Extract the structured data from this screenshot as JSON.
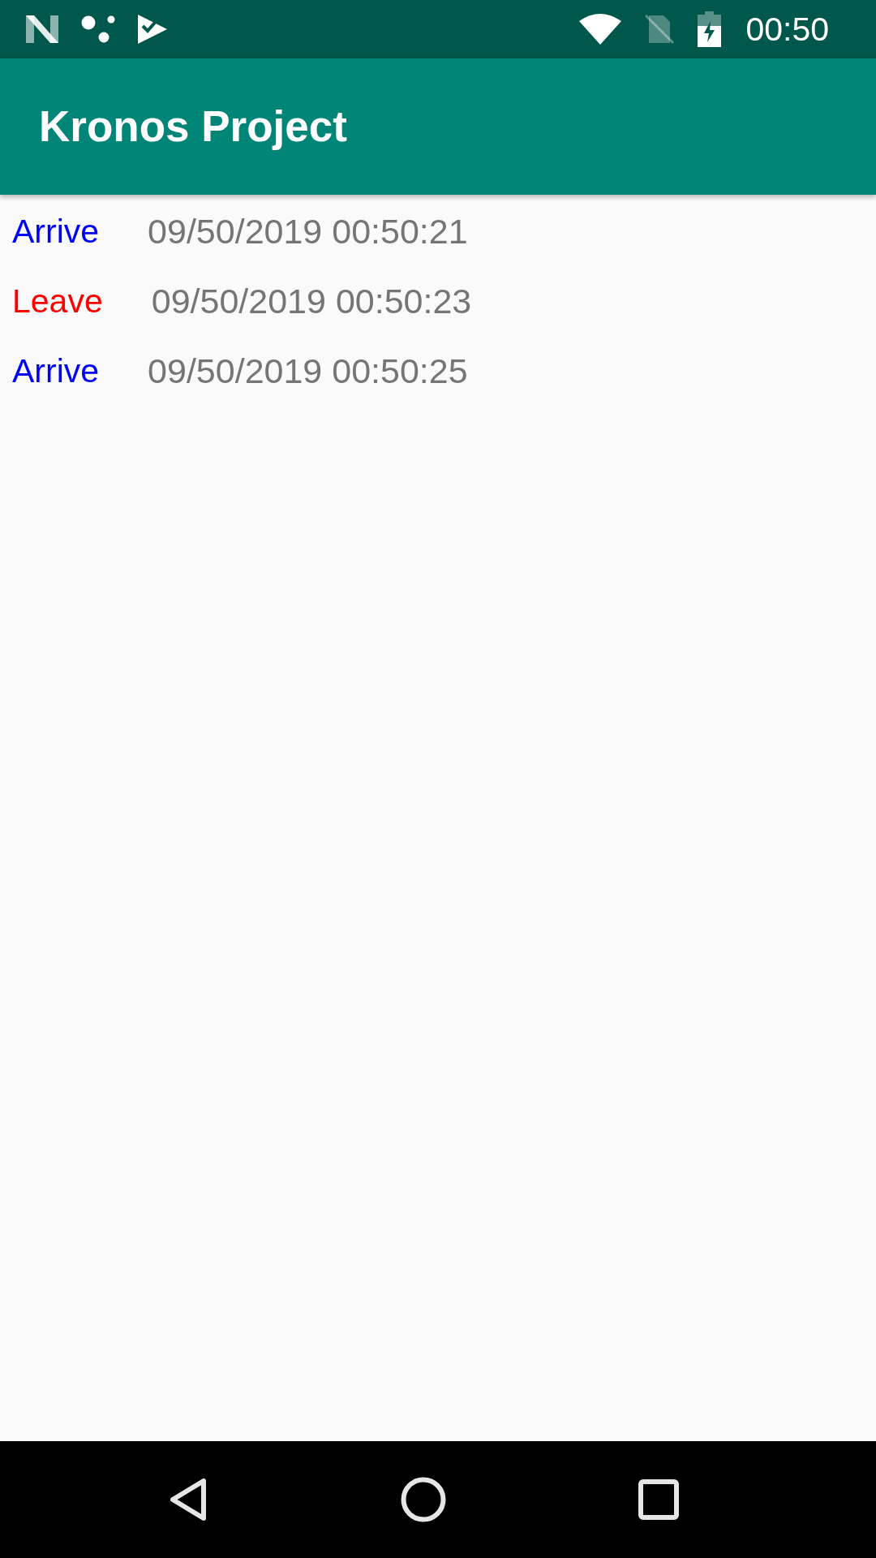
{
  "status_bar": {
    "time": "00:50"
  },
  "app_bar": {
    "title": "Kronos Project"
  },
  "entries": [
    {
      "label": "Arrive",
      "color": "#0000ff",
      "timestamp": "09/50/2019 00:50:21"
    },
    {
      "label": "Leave",
      "color": "#ff0000",
      "timestamp": "09/50/2019 00:50:23"
    },
    {
      "label": "Arrive",
      "color": "#0000ff",
      "timestamp": "09/50/2019 00:50:25"
    }
  ]
}
